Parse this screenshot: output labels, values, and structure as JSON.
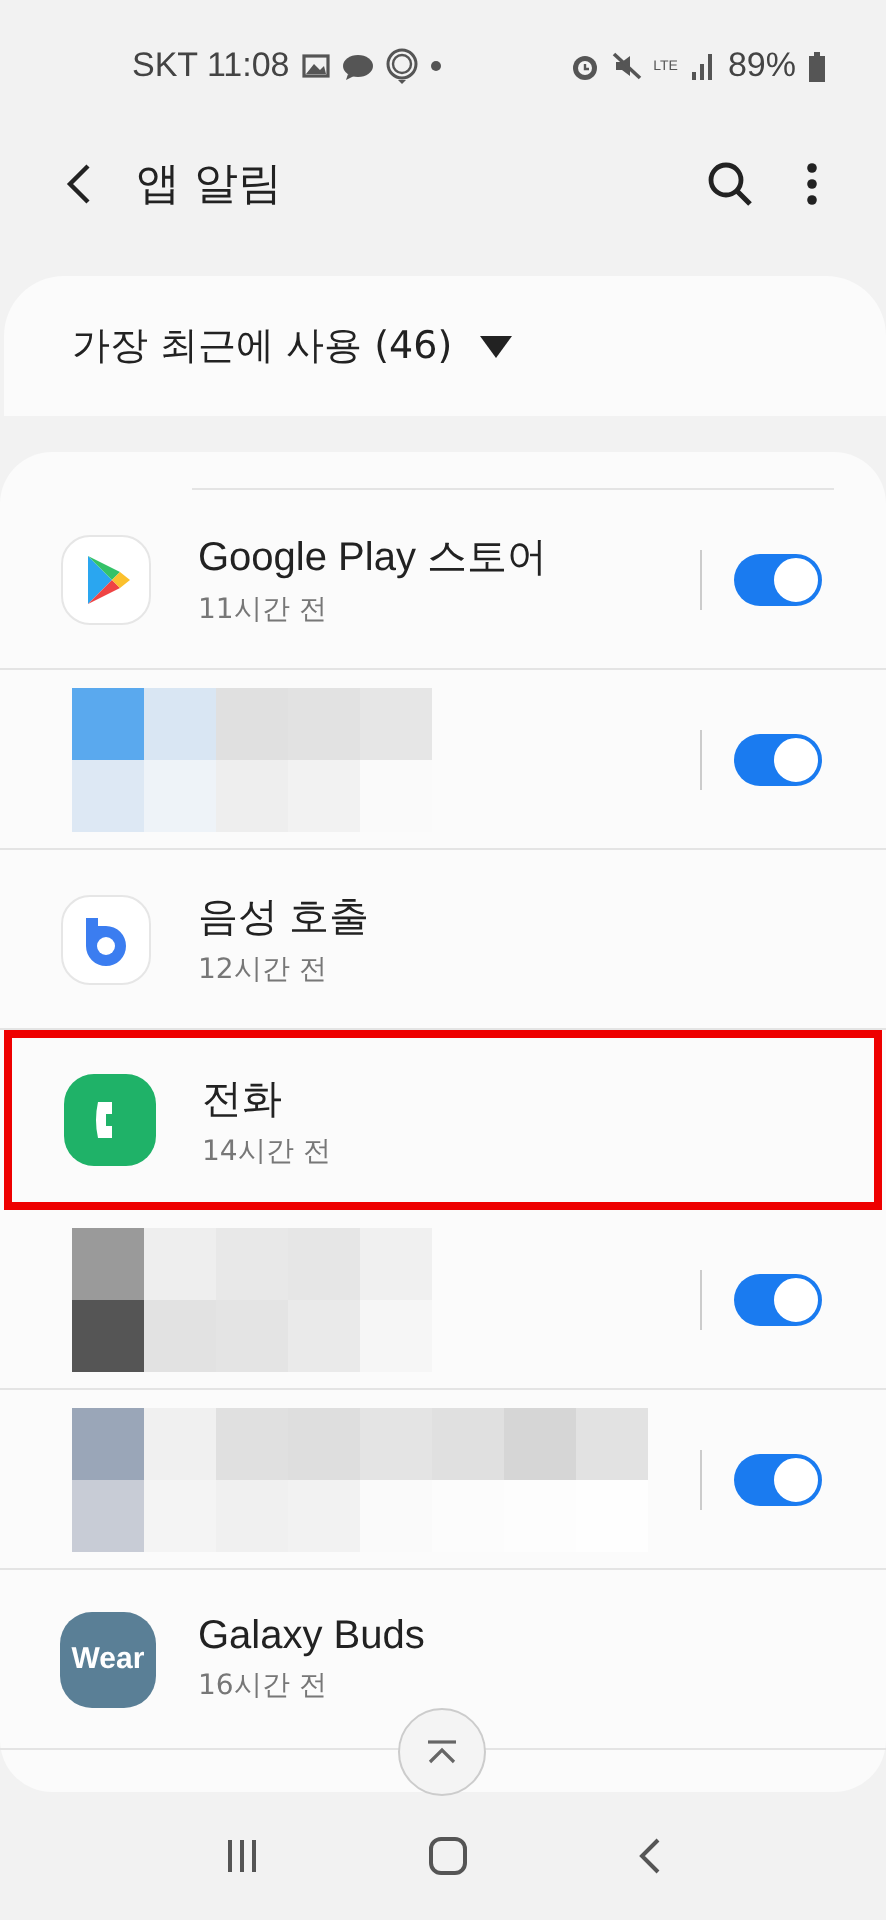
{
  "status_bar": {
    "carrier_time": "SKT 11:08",
    "network": "LTE",
    "battery": "89%"
  },
  "header": {
    "title": "앱 알림"
  },
  "sort_dropdown": {
    "label": "가장 최근에 사용 (46)"
  },
  "rows": [
    {
      "kind": "app",
      "name": "Google Play 스토어",
      "time": "11시간 전",
      "toggle": true,
      "highlighted": false
    },
    {
      "kind": "masked",
      "toggle": true,
      "highlighted": false
    },
    {
      "kind": "app",
      "name": "음성 호출",
      "time": "12시간 전",
      "highlighted": false
    },
    {
      "kind": "app",
      "name": "전화",
      "time": "14시간 전",
      "highlighted": true
    },
    {
      "kind": "masked",
      "toggle": true,
      "highlighted": false
    },
    {
      "kind": "masked",
      "toggle": true,
      "highlighted": false
    },
    {
      "kind": "app",
      "icon_label": "Wear",
      "name": "Galaxy Buds",
      "time": "16시간 전",
      "highlighted": false
    }
  ]
}
